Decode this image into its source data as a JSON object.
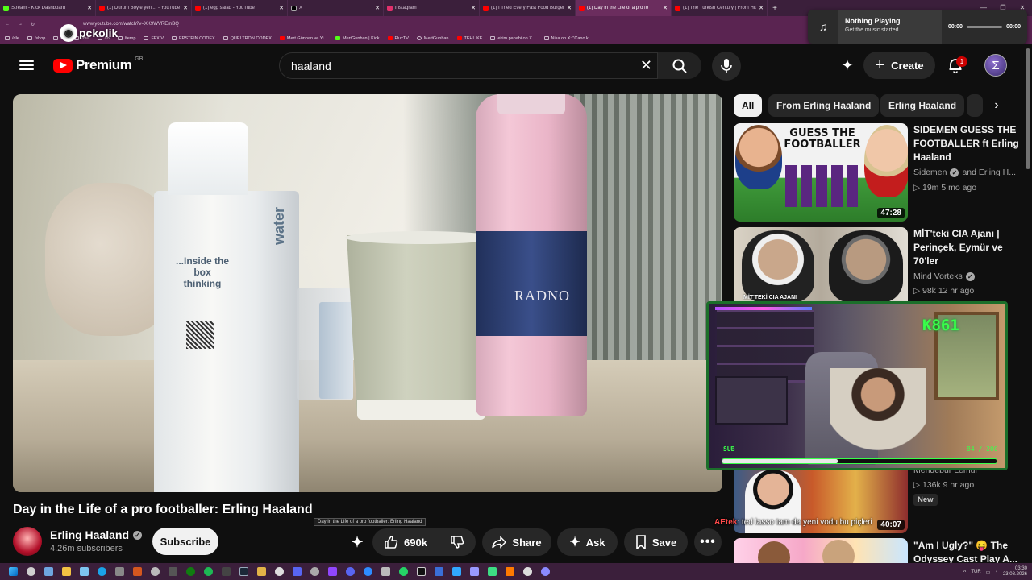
{
  "browser": {
    "tabs": [
      {
        "label": "Stream - Kick Dashboard",
        "color": "#53fc18"
      },
      {
        "label": "(1) Durum Boyle yeni...  - YouTube",
        "color": "#ff0000"
      },
      {
        "label": "(1) egg salad - YouTube",
        "color": "#ff0000"
      },
      {
        "label": "X",
        "color": "#000000"
      },
      {
        "label": "Instagram",
        "color": "#e1306c"
      },
      {
        "label": "(1) I Tried Every Fast Food Burger i",
        "color": "#ff0000"
      },
      {
        "label": "(1) Day in the Life of a pro fo",
        "color": "#ff0000"
      },
      {
        "label": "(1) The Turkish Century | From Hit",
        "color": "#ff0000"
      }
    ],
    "active_tab": 6,
    "url": "www.youtube.com/watch?v=XK9WVREmBQ",
    "bookmarks": [
      "/dle",
      "/shop",
      "/ck",
      "/mu",
      "/to",
      "/temp",
      "FFXIV",
      "EPSTEIN CODEX",
      "QUELTRON CODEX",
      "Mert Günhan ve Yi...",
      "MertGunhan | Kick",
      "FluxTV",
      "MertGunhan",
      "TEHLIKE",
      "ekim panahi on X...",
      "Nisa on X: \"Cano k..."
    ],
    "watermark": "pckolik"
  },
  "media_popup": {
    "title": "Nothing Playing",
    "subtitle": "Get the music started",
    "time_start": "00:00",
    "time_end": "00:00"
  },
  "header": {
    "logo": "Premium",
    "country": "GB",
    "search_query": "haaland",
    "create_label": "Create",
    "notification_count": "1"
  },
  "video": {
    "title": "Day in the Life of a pro footballer: Erling Haaland",
    "tooltip": "Day in the Life of a pro footballer: Erling Haaland",
    "carton_text": "...Inside the box thinking",
    "carton_brand": "water",
    "bottle_brand": "RADNO"
  },
  "channel": {
    "name": "Erling Haaland",
    "subs": "4.26m subscribers",
    "subscribe_label": "Subscribe"
  },
  "actions": {
    "likes": "690k",
    "share": "Share",
    "ask": "Ask",
    "save": "Save"
  },
  "chips": [
    "All",
    "From Erling Haaland",
    "Erling Haaland"
  ],
  "suggestions": [
    {
      "title": "SIDEMEN GUESS THE FOOTBALLER ft Erling Haaland",
      "channel": "Sidemen",
      "channel_extra": "and Erling H...",
      "meta": "▷ 19m   5 mo ago",
      "duration": "47:28",
      "thumb_text": "GUESS THE FOOTBALLER"
    },
    {
      "title": "MİT'teki CIA Ajanı | Perinçek, Eymür ve 70'ler",
      "channel": "Mind Vorteks",
      "meta": "▷ 98k   12 hr ago",
      "thumb_text": "MİT'TEKİ CIA AJANI"
    },
    {
      "title": "",
      "channel": "Mendebur Lemur",
      "meta": "▷ 136k   9 hr ago",
      "badge": "New",
      "duration": "40:07"
    },
    {
      "title": "\"Am I Ugly?\" 😝 The Odyssey Cast Play A..."
    }
  ],
  "stream": {
    "counter": "K861",
    "sub_label": "SUB",
    "goal": "84 / 200",
    "progress": 0.42
  },
  "chat": {
    "user": "AEtek",
    "message": ": ted lasso tam da yeni vodu bu piçleri"
  },
  "taskbar": {
    "lang": "TUR",
    "time": "03:30",
    "date": "23.08.2026"
  }
}
